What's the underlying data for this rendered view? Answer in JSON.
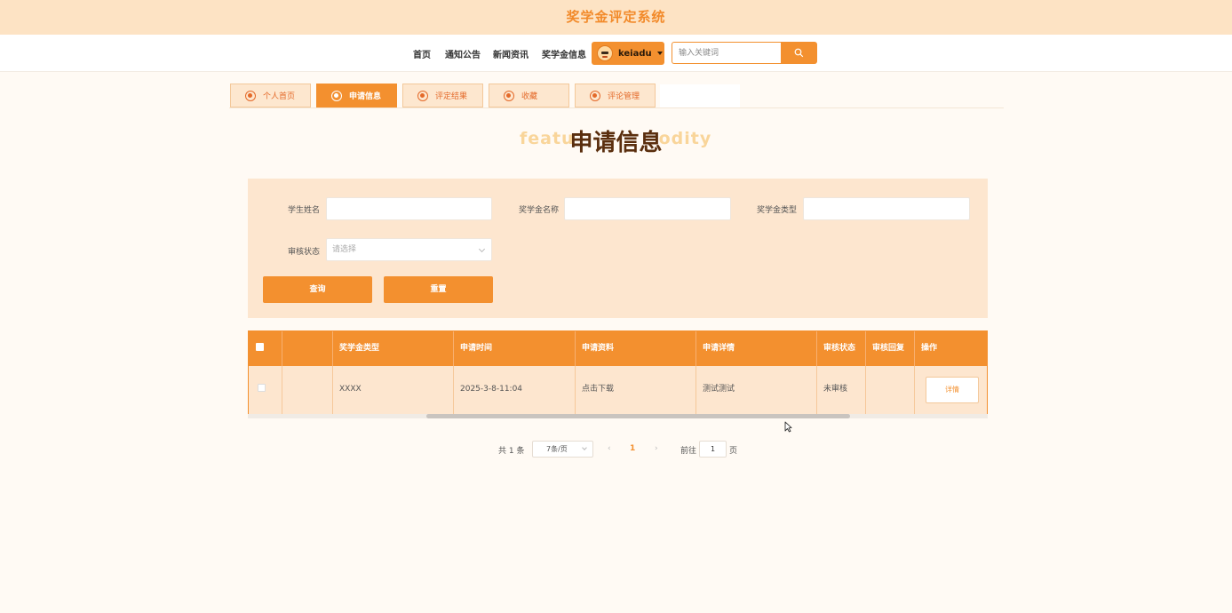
{
  "header": {
    "title": "奖学金评定系统"
  },
  "nav": {
    "links": [
      "首页",
      "通知公告",
      "新闻资讯",
      "奖学金信息"
    ],
    "user": "keiadu",
    "search_placeholder": "输入关键词"
  },
  "tabs": [
    {
      "label": "个人首页",
      "active": false
    },
    {
      "label": "申请信息",
      "active": true
    },
    {
      "label": "评定结果",
      "active": false
    },
    {
      "label": "收藏",
      "active": false
    },
    {
      "label": "评论管理",
      "active": false
    }
  ],
  "page": {
    "heading": "申请信息",
    "heading_bg_left": "featu",
    "heading_bg_right": "odity"
  },
  "filters": {
    "student_name_label": "学生姓名",
    "scholarship_name_label": "奖学金名称",
    "scholarship_type_label": "奖学金类型",
    "status_label": "审核状态",
    "status_placeholder": "请选择",
    "query_button": "查询",
    "reset_button": "重置"
  },
  "table": {
    "columns": [
      "",
      "",
      "奖学金类型",
      "申请时间",
      "申请资料",
      "申请详情",
      "审核状态",
      "审核回复",
      "操作"
    ],
    "rows": [
      {
        "type": "XXXX",
        "time": "2025-3-8-11:04",
        "material": "点击下载",
        "detail": "测试测试",
        "status": "未审核",
        "reply": "",
        "action": "详情"
      }
    ]
  },
  "pagination": {
    "total": "共 1 条",
    "page_size": "7条/页",
    "current_page": "1",
    "prev": "‹",
    "next": "›",
    "goto_label": "前往",
    "goto_value": "1",
    "page_suffix": "页"
  },
  "colors": {
    "accent": "#f3902f",
    "panel": "#fde6cf",
    "header": "#fde3c4"
  }
}
